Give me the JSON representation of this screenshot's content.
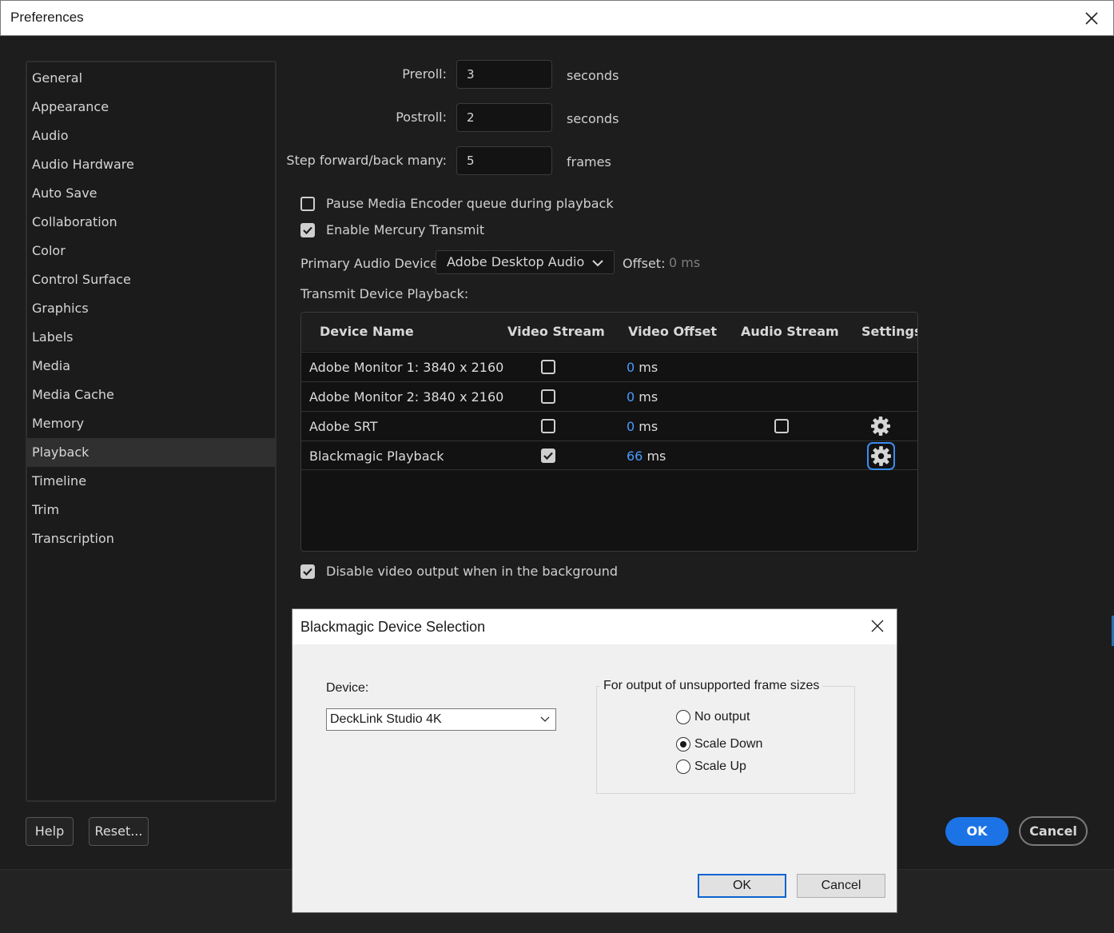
{
  "window": {
    "title": "Preferences"
  },
  "sidebar": {
    "items": [
      {
        "label": "General"
      },
      {
        "label": "Appearance"
      },
      {
        "label": "Audio"
      },
      {
        "label": "Audio Hardware"
      },
      {
        "label": "Auto Save"
      },
      {
        "label": "Collaboration"
      },
      {
        "label": "Color"
      },
      {
        "label": "Control Surface"
      },
      {
        "label": "Graphics"
      },
      {
        "label": "Labels"
      },
      {
        "label": "Media"
      },
      {
        "label": "Media Cache"
      },
      {
        "label": "Memory"
      },
      {
        "label": "Playback"
      },
      {
        "label": "Timeline"
      },
      {
        "label": "Trim"
      },
      {
        "label": "Transcription"
      }
    ],
    "selected": "Playback"
  },
  "playback": {
    "preroll": {
      "label": "Preroll:",
      "value": "3",
      "unit": "seconds"
    },
    "postroll": {
      "label": "Postroll:",
      "value": "2",
      "unit": "seconds"
    },
    "step": {
      "label": "Step forward/back many:",
      "value": "5",
      "unit": "frames"
    },
    "pause_media_encoder": {
      "label": "Pause Media Encoder queue during playback",
      "checked": false
    },
    "enable_mercury": {
      "label": "Enable Mercury Transmit",
      "checked": true
    },
    "primary_audio": {
      "label": "Primary Audio Device:",
      "value": "Adobe Desktop Audio"
    },
    "offset": {
      "label": "Offset:",
      "value": "0 ms"
    },
    "transmit_label": "Transmit Device Playback:",
    "table": {
      "headers": [
        "Device Name",
        "Video Stream",
        "Video Offset",
        "Audio Stream",
        "Settings"
      ],
      "rows": [
        {
          "name": "Adobe Monitor 1: 3840 x 2160",
          "video_stream": false,
          "offset": "0",
          "unit": "ms"
        },
        {
          "name": "Adobe Monitor 2: 3840 x 2160",
          "video_stream": false,
          "offset": "0",
          "unit": "ms"
        },
        {
          "name": "Adobe SRT",
          "video_stream": false,
          "offset": "0",
          "unit": "ms",
          "audio_stream": false
        },
        {
          "name": "Blackmagic Playback",
          "video_stream": true,
          "offset": "66",
          "unit": "ms"
        }
      ]
    },
    "disable_background": {
      "label": "Disable video output when in the background",
      "checked": true
    }
  },
  "footer": {
    "help": "Help",
    "reset": "Reset...",
    "ok": "OK",
    "cancel": "Cancel"
  },
  "blackmagic_dialog": {
    "title": "Blackmagic Device Selection",
    "device_label": "Device:",
    "device_value": "DeckLink Studio 4K",
    "group_label": "For output of unsupported frame sizes",
    "options": [
      {
        "label": "No output",
        "selected": false
      },
      {
        "label": "Scale Down",
        "selected": true
      },
      {
        "label": "Scale Up",
        "selected": false
      }
    ],
    "ok": "OK",
    "cancel": "Cancel"
  },
  "colors": {
    "accent": "#1c73e6",
    "value_blue": "#4a9bff"
  }
}
